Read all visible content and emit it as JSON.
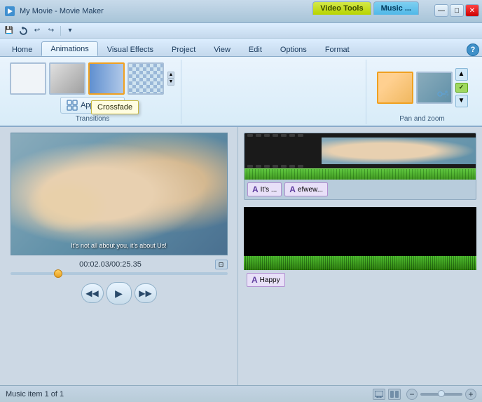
{
  "titleBar": {
    "title": "My Movie - Movie Maker",
    "toolTabs": [
      {
        "id": "video-tools",
        "label": "Video Tools",
        "active": false
      },
      {
        "id": "music-tools",
        "label": "Music ...",
        "active": true
      }
    ],
    "windowControls": {
      "minimize": "—",
      "maximize": "□",
      "close": "✕"
    }
  },
  "quickAccess": {
    "buttons": [
      "💾",
      "⟳",
      "↩",
      "↪",
      "▾"
    ]
  },
  "ribbonTabs": [
    {
      "id": "home",
      "label": "Home",
      "active": false
    },
    {
      "id": "animations",
      "label": "Animations",
      "active": true
    },
    {
      "id": "visual-effects",
      "label": "Visual Effects",
      "active": false
    },
    {
      "id": "project",
      "label": "Project",
      "active": false
    },
    {
      "id": "view",
      "label": "View",
      "active": false
    },
    {
      "id": "edit",
      "label": "Edit",
      "active": false
    },
    {
      "id": "options",
      "label": "Options",
      "active": false
    },
    {
      "id": "format",
      "label": "Format",
      "active": false
    }
  ],
  "ribbon": {
    "transitions": {
      "label": "Transitions",
      "thumbs": [
        {
          "id": "blank",
          "type": "blank"
        },
        {
          "id": "gray",
          "type": "gray"
        },
        {
          "id": "crossfade",
          "type": "crossfade",
          "active": true
        },
        {
          "id": "checker",
          "type": "checker"
        }
      ],
      "applyAll": "Apply to all",
      "tooltip": "Crossfade"
    },
    "panZoom": {
      "label": "Pan and zoom",
      "checkIcon": "✓"
    }
  },
  "preview": {
    "timeDisplay": "00:02.03/00:25.35",
    "caption": "It's not all about you, it's about Us!",
    "expandIcon": "⊡"
  },
  "timeline": {
    "textClips": [
      {
        "label": "It's ...",
        "icon": "A"
      },
      {
        "label": "efwew...",
        "icon": "A"
      }
    ],
    "happyClip": {
      "label": "Happy",
      "icon": "A"
    }
  },
  "statusBar": {
    "text": "Music item 1 of 1",
    "zoomMinus": "−",
    "zoomPlus": "+"
  },
  "playback": {
    "prevFrame": "◀◀",
    "play": "▶",
    "nextFrame": "▶▶"
  }
}
